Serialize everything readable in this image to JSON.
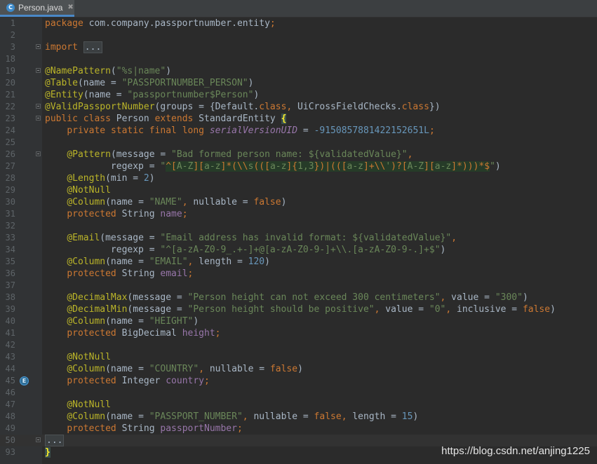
{
  "tab": {
    "icon": "java-class-icon",
    "icon_letter": "C",
    "filename": "Person.java",
    "close_glyph": "✖"
  },
  "gutter_marker": {
    "icon": "entity-marker-icon",
    "letter": "E",
    "line": "45"
  },
  "lines": [
    {
      "n": "1",
      "code": "package com.company.passportnumber.entity;"
    },
    {
      "n": "2",
      "code": ""
    },
    {
      "n": "3",
      "code": "import ..."
    },
    {
      "n": "18",
      "code": ""
    },
    {
      "n": "19",
      "code": "@NamePattern(\"%s|name\")"
    },
    {
      "n": "20",
      "code": "@Table(name = \"PASSPORTNUMBER_PERSON\")"
    },
    {
      "n": "21",
      "code": "@Entity(name = \"passportnumber$Person\")"
    },
    {
      "n": "22",
      "code": "@ValidPassportNumber(groups = {Default.class, UiCrossFieldChecks.class})"
    },
    {
      "n": "23",
      "code": "public class Person extends StandardEntity {"
    },
    {
      "n": "24",
      "code": "    private static final long serialVersionUID = -9150857881422152651L;"
    },
    {
      "n": "25",
      "code": ""
    },
    {
      "n": "26",
      "code": "    @Pattern(message = \"Bad formed person name: ${validatedValue}\","
    },
    {
      "n": "27",
      "code": "            regexp = \"^[A-Z][a-z]*(\\\\s(([a-z]{1,3})|(([a-z]+\\\\')?[A-Z][a-z]*)))*$\")"
    },
    {
      "n": "28",
      "code": "    @Length(min = 2)"
    },
    {
      "n": "29",
      "code": "    @NotNull"
    },
    {
      "n": "30",
      "code": "    @Column(name = \"NAME\", nullable = false)"
    },
    {
      "n": "31",
      "code": "    protected String name;"
    },
    {
      "n": "32",
      "code": ""
    },
    {
      "n": "33",
      "code": "    @Email(message = \"Email address has invalid format: ${validatedValue}\","
    },
    {
      "n": "34",
      "code": "            regexp = \"^[a-zA-Z0-9_.+-]+@[a-zA-Z0-9-]+\\\\.[a-zA-Z0-9-.]+$\")"
    },
    {
      "n": "35",
      "code": "    @Column(name = \"EMAIL\", length = 120)"
    },
    {
      "n": "36",
      "code": "    protected String email;"
    },
    {
      "n": "37",
      "code": ""
    },
    {
      "n": "38",
      "code": "    @DecimalMax(message = \"Person height can not exceed 300 centimeters\", value = \"300\")"
    },
    {
      "n": "39",
      "code": "    @DecimalMin(message = \"Person height should be positive\", value = \"0\", inclusive = false)"
    },
    {
      "n": "40",
      "code": "    @Column(name = \"HEIGHT\")"
    },
    {
      "n": "41",
      "code": "    protected BigDecimal height;"
    },
    {
      "n": "42",
      "code": ""
    },
    {
      "n": "43",
      "code": "    @NotNull"
    },
    {
      "n": "44",
      "code": "    @Column(name = \"COUNTRY\", nullable = false)"
    },
    {
      "n": "45",
      "code": "    protected Integer country;"
    },
    {
      "n": "46",
      "code": ""
    },
    {
      "n": "47",
      "code": "    @NotNull"
    },
    {
      "n": "48",
      "code": "    @Column(name = \"PASSPORT_NUMBER\", nullable = false, length = 15)"
    },
    {
      "n": "49",
      "code": "    protected String passportNumber;"
    },
    {
      "n": "50",
      "code": "..."
    },
    {
      "n": "93",
      "code": "}"
    }
  ],
  "watermark": "https://blog.csdn.net/anjing1225",
  "colors": {
    "background": "#2b2b2b",
    "gutter": "#313335",
    "keyword": "#cc7832",
    "annotation": "#bbb529",
    "string": "#6a8759",
    "number": "#6897bb",
    "field": "#9876aa",
    "text": "#a9b7c6"
  }
}
